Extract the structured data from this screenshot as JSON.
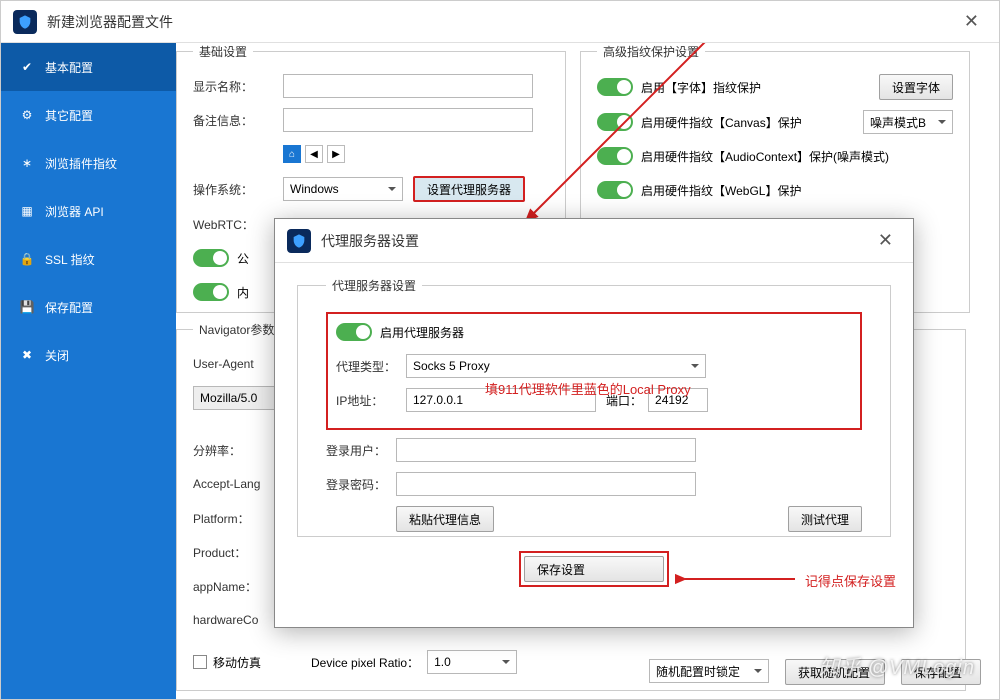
{
  "window": {
    "title": "新建浏览器配置文件"
  },
  "sidebar": {
    "items": [
      {
        "label": "基本配置"
      },
      {
        "label": "其它配置"
      },
      {
        "label": "浏览插件指纹"
      },
      {
        "label": "浏览器 API"
      },
      {
        "label": "SSL 指纹"
      },
      {
        "label": "保存配置"
      },
      {
        "label": "关闭"
      }
    ]
  },
  "basic": {
    "legend": "基础设置",
    "display_name": "显示名称：",
    "remark": "备注信息：",
    "os": "操作系统：",
    "os_value": "Windows",
    "proxy_btn": "设置代理服务器",
    "webrtc": "WebRTC：",
    "public": "公",
    "internal": "内"
  },
  "advanced": {
    "legend": "高级指纹保护设置",
    "font": "启用【字体】指纹保护",
    "font_btn": "设置字体",
    "canvas": "启用硬件指纹【Canvas】保护",
    "canvas_mode": "噪声模式B",
    "audio": "启用硬件指纹【AudioContext】保护(噪声模式)",
    "webgl": "启用硬件指纹【WebGL】保护"
  },
  "nav": {
    "legend": "Navigator参数",
    "ua": "User-Agent",
    "ua_value": "Mozilla/5.0",
    "resolution": "分辨率：",
    "lang": "Accept-Lang",
    "platform": "Platform：",
    "product": "Product：",
    "appname": "appName：",
    "hardware": "hardwareCo",
    "mobile": "移动仿真",
    "dpr": "Device pixel Ratio：",
    "dpr_value": "1.0"
  },
  "bottom": {
    "b1": "随机配置时锁定",
    "b2": "获取随机配置",
    "b3": "保存配置"
  },
  "modal": {
    "title": "代理服务器设置",
    "legend": "代理服务器设置",
    "enable": "启用代理服务器",
    "type": "代理类型：",
    "type_value": "Socks 5 Proxy",
    "ip": "IP地址：",
    "ip_value": "127.0.0.1",
    "port": "端口：",
    "port_value": "24192",
    "user": "登录用户：",
    "pass": "登录密码：",
    "paste": "粘贴代理信息",
    "test": "测试代理",
    "save": "保存设置"
  },
  "annotations": {
    "a1": "填911代理软件里蓝色的Local Proxy",
    "a2": "记得点保存设置"
  },
  "watermark": "知乎 @VMLogin"
}
